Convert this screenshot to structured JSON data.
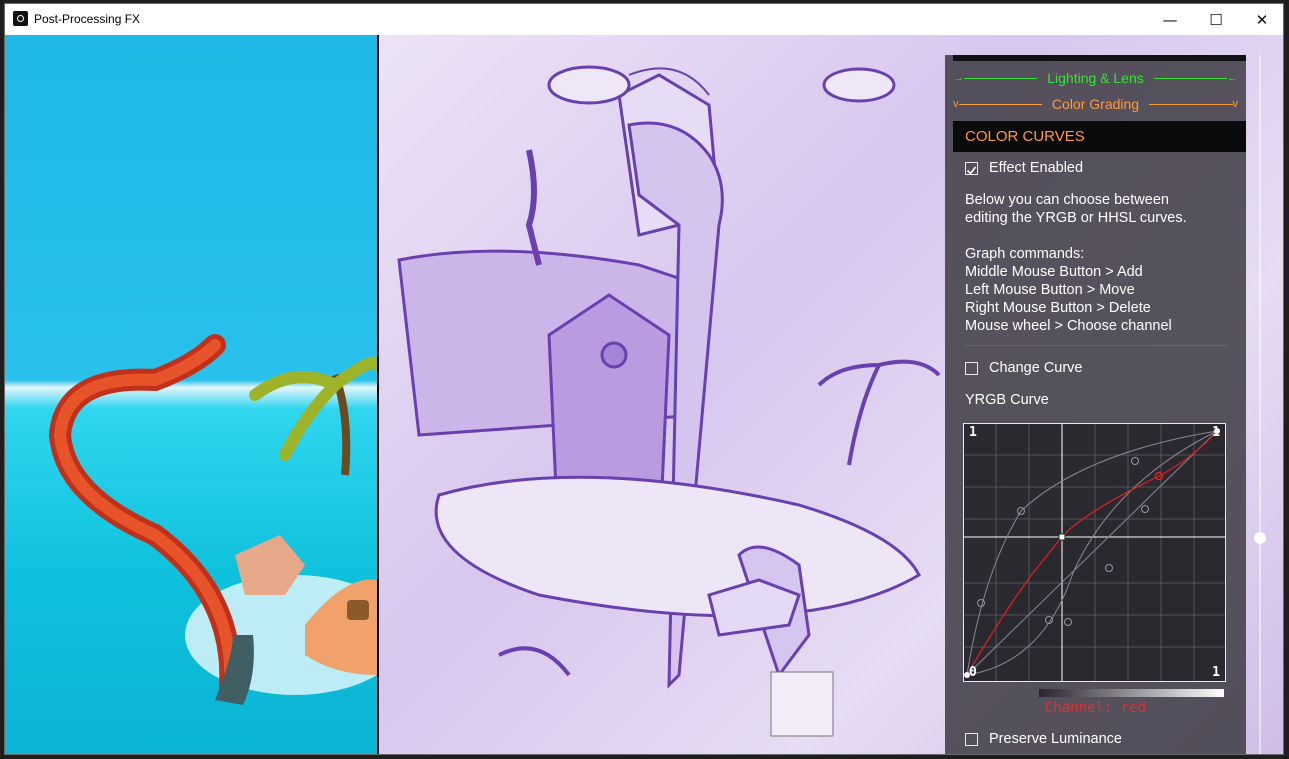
{
  "window": {
    "title": "Post-Processing FX",
    "minimize_glyph": "—",
    "maximize_glyph": "☐",
    "close_glyph": "✕"
  },
  "panel": {
    "sections": [
      {
        "label": "Lighting & Lens",
        "color": "#3adf3a",
        "icon": "arrow-icon"
      },
      {
        "label": "Color Grading",
        "color": "#ff9a3c",
        "icon": "chevron-down-icon"
      }
    ],
    "header": "COLOR CURVES",
    "effect_enabled": {
      "label": "Effect Enabled",
      "checked": true
    },
    "description": "Below you can choose between\nediting the YRGB or HHSL curves.",
    "commands_title": "Graph commands:",
    "commands": [
      "Middle Mouse Button > Add",
      "Left Mouse Button > Move",
      "Right Mouse Button > Delete",
      "Mouse wheel > Choose channel"
    ],
    "change_curve": {
      "label": "Change Curve",
      "checked": false
    },
    "curve_title": "YRGB Curve",
    "graph": {
      "label_top_left": "1",
      "label_top_right": "1",
      "label_bottom_left": "0",
      "label_bottom_right": "1",
      "active_color": "#e02020"
    },
    "channel_label": "Channel: red",
    "preserve_luminance_label": "Preserve Luminance"
  }
}
